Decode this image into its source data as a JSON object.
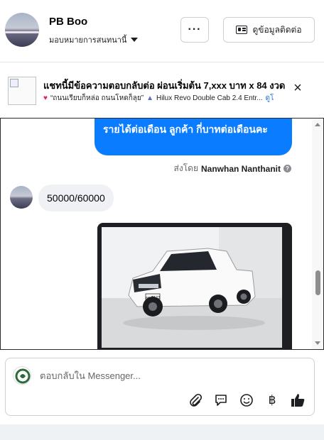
{
  "header": {
    "page_name": "PB Boo",
    "assignee": "มอบหมายการสนทนานี้",
    "more_label": "···",
    "contact_label": "ดูข้อมูลติดต่อ"
  },
  "ad": {
    "title": "แชทนี้มีข้อความตอบกลับต่อ ผ่อนเริ่มต้น 7,xxx บาท x 84 งวด",
    "line_part1": "“ถนนเรียบก็หล่อ ถนนโหดก็ลุย”",
    "line_part2": "Hilux Revo Double Cab 2.4 Entr...",
    "view_link": "ดูโ",
    "close_label": "×"
  },
  "chat": {
    "outgoing_text": "รายได้ต่อเดือน ลูกค้า  กี่บาทต่อเดือนคะ",
    "sent_by_prefix": "ส่งโดย",
    "sent_by_name": "Nanwhan Nanthanit",
    "help_label": "?",
    "incoming_text": "50000/60000",
    "plate_text": "ดด 7123"
  },
  "composer": {
    "placeholder": "ตอบกลับใน Messenger..."
  },
  "colors": {
    "messenger_blue": "#0a7cff",
    "bubble_gray": "#eff1f4"
  }
}
